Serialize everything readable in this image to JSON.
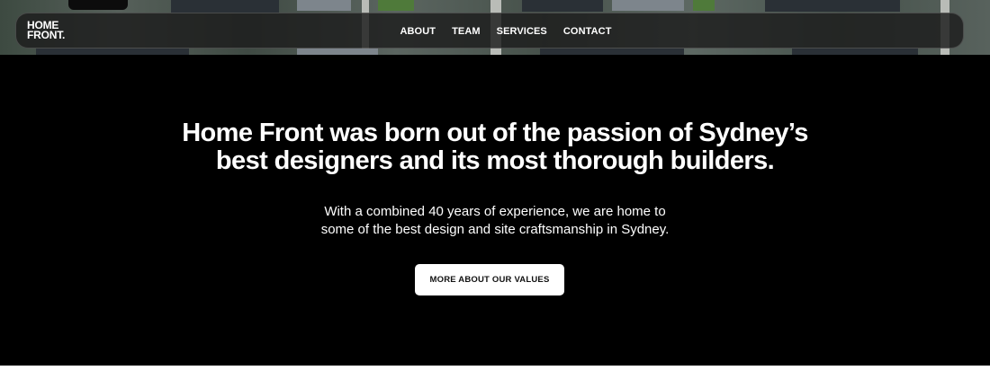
{
  "header": {
    "logo_line1": "HOME",
    "logo_line2": "FRONT.",
    "nav": [
      "ABOUT",
      "TEAM",
      "SERVICES",
      "CONTACT"
    ]
  },
  "hero": {
    "headline_line1": "Home Front was born out of the passion of Sydney’s",
    "headline_line2": "best designers and its most thorough builders.",
    "sub_line1": "With a combined 40 years of experience, we are home to",
    "sub_line2": "some of the best design and site craftsmanship in Sydney.",
    "cta_label": "MORE ABOUT OUR VALUES"
  },
  "colors": {
    "dark_section": "#000000",
    "button_bg": "#ffffff",
    "nav_bg": "#1c1c1c"
  }
}
